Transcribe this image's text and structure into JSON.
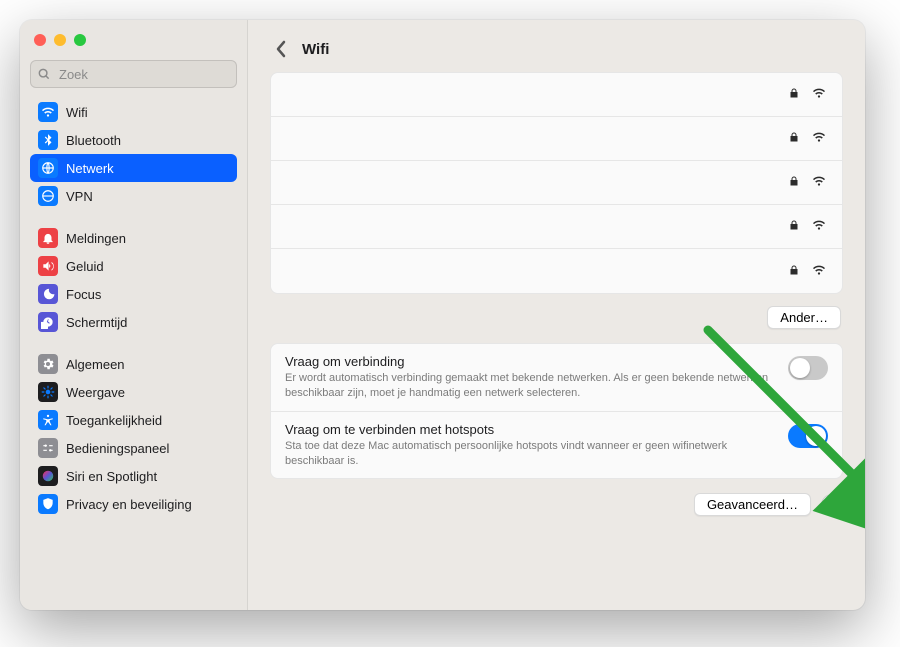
{
  "search": {
    "placeholder": "Zoek"
  },
  "page": {
    "title": "Wifi"
  },
  "sidebar": {
    "groups": [
      [
        {
          "id": "wifi",
          "label": "Wifi",
          "bg": "#0a7aff",
          "fg": "#fff"
        },
        {
          "id": "bluetooth",
          "label": "Bluetooth",
          "bg": "#0a7aff",
          "fg": "#fff"
        },
        {
          "id": "netwerk",
          "label": "Netwerk",
          "bg": "#0a7aff",
          "fg": "#fff",
          "selected": true
        },
        {
          "id": "vpn",
          "label": "VPN",
          "bg": "#0a7aff",
          "fg": "#fff"
        }
      ],
      [
        {
          "id": "meldingen",
          "label": "Meldingen",
          "bg": "#ed4145",
          "fg": "#fff"
        },
        {
          "id": "geluid",
          "label": "Geluid",
          "bg": "#ed4145",
          "fg": "#fff"
        },
        {
          "id": "focus",
          "label": "Focus",
          "bg": "#5856d6",
          "fg": "#fff"
        },
        {
          "id": "schermtijd",
          "label": "Schermtijd",
          "bg": "#5856d6",
          "fg": "#fff"
        }
      ],
      [
        {
          "id": "algemeen",
          "label": "Algemeen",
          "bg": "#8e8e93",
          "fg": "#fff"
        },
        {
          "id": "weergave",
          "label": "Weergave",
          "bg": "#1d1d1f",
          "fg": "#0a7aff"
        },
        {
          "id": "toegankelijkheid",
          "label": "Toegankelijkheid",
          "bg": "#0a7aff",
          "fg": "#fff"
        },
        {
          "id": "bedieningspaneel",
          "label": "Bedieningspaneel",
          "bg": "#8e8e93",
          "fg": "#fff"
        },
        {
          "id": "siri",
          "label": "Siri en Spotlight",
          "bg": "#1d1d1f",
          "fg": "#fff",
          "siri": true
        },
        {
          "id": "privacy",
          "label": "Privacy en beveiliging",
          "bg": "#0a7aff",
          "fg": "#fff"
        }
      ]
    ]
  },
  "networks": [
    {
      "locked": true
    },
    {
      "locked": true
    },
    {
      "locked": true
    },
    {
      "locked": true
    },
    {
      "locked": true
    }
  ],
  "buttons": {
    "other": "Ander…",
    "advanced": "Geavanceerd…",
    "help": "?"
  },
  "settings": {
    "ask_connect": {
      "title": "Vraag om verbinding",
      "desc": "Er wordt automatisch verbinding gemaakt met bekende netwerken. Als er geen bekende netwerken beschikbaar zijn, moet je handmatig een netwerk selecteren.",
      "on": false
    },
    "ask_hotspot": {
      "title": "Vraag om te verbinden met hotspots",
      "desc": "Sta toe dat deze Mac automatisch persoonlijke hotspots vindt wanneer er geen wifinetwerk beschikbaar is.",
      "on": true
    }
  }
}
